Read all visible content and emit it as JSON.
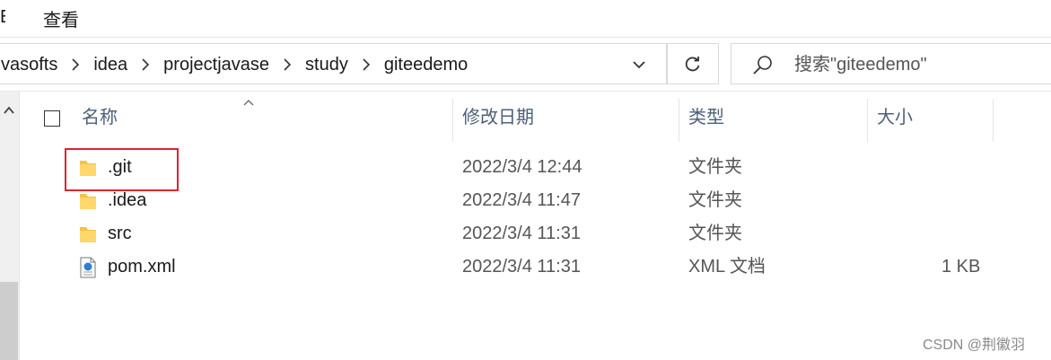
{
  "ribbon": {
    "edge_char": "E",
    "tab_view": "查看"
  },
  "address": {
    "segments": [
      "vasofts",
      "idea",
      "projectjavase",
      "study",
      "giteedemo"
    ]
  },
  "search": {
    "placeholder": "搜索\"giteedemo\""
  },
  "columns": {
    "name": "名称",
    "modified": "修改日期",
    "type": "类型",
    "size": "大小"
  },
  "files": [
    {
      "name": ".git",
      "modified": "2022/3/4 12:44",
      "type": "文件夹",
      "size": "",
      "icon": "folder-icon"
    },
    {
      "name": ".idea",
      "modified": "2022/3/4 11:47",
      "type": "文件夹",
      "size": "",
      "icon": "folder-icon"
    },
    {
      "name": "src",
      "modified": "2022/3/4 11:31",
      "type": "文件夹",
      "size": "",
      "icon": "folder-icon"
    },
    {
      "name": "pom.xml",
      "modified": "2022/3/4 11:31",
      "type": "XML 文档",
      "size": "1 KB",
      "icon": "xml-file-icon"
    }
  ],
  "watermark": "CSDN @荆徽羽",
  "colors": {
    "highlight": "#d9262f",
    "header_text": "#4c607a",
    "folder": "#f5c242"
  }
}
